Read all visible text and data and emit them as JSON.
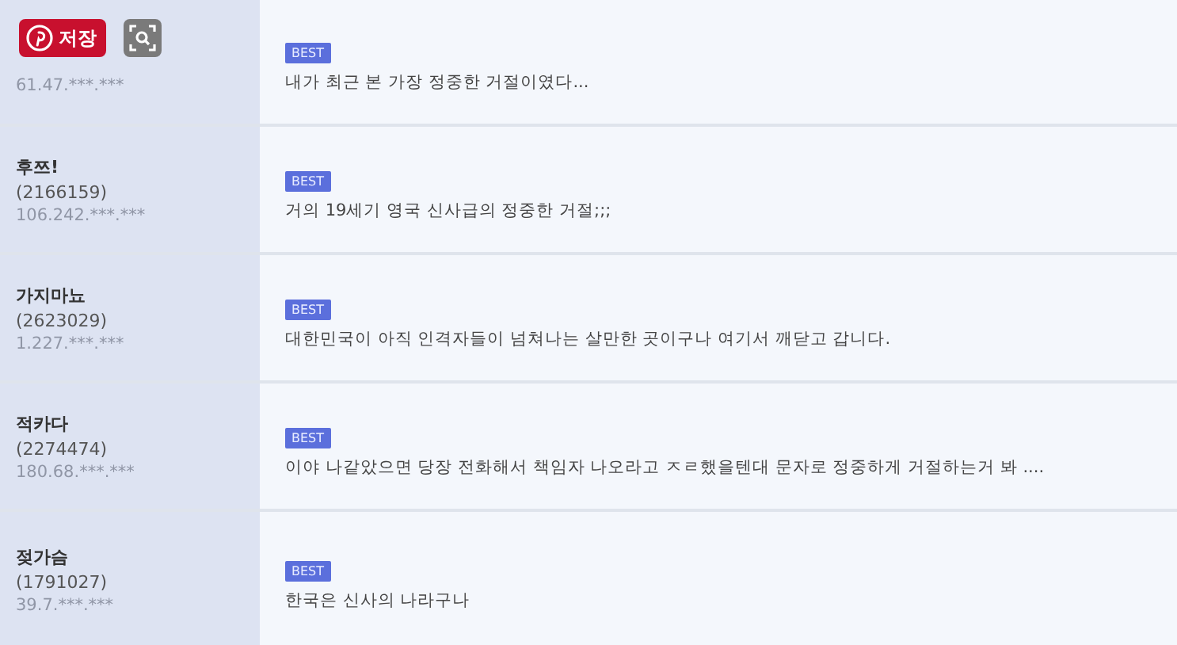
{
  "overlay": {
    "save_label": "저장"
  },
  "comments": [
    {
      "ip": "61.47.***.***",
      "badge": "BEST",
      "text": "내가 최근 본 가장 정중한 거절이였다..."
    },
    {
      "name": "후쯔!",
      "user_id": "(2166159)",
      "ip": "106.242.***.***",
      "badge": "BEST",
      "text": "거의 19세기 영국 신사급의 정중한 거절;;;"
    },
    {
      "name": "가지마뇨",
      "user_id": "(2623029)",
      "ip": "1.227.***.***",
      "badge": "BEST",
      "text": "대한민국이 아직 인격자들이 넘쳐나는 살만한 곳이구나 여기서 깨닫고 갑니다."
    },
    {
      "name": "적카다",
      "user_id": "(2274474)",
      "ip": "180.68.***.***",
      "badge": "BEST",
      "text": "이야 나같았으면 당장 전화해서 책임자 나오라고 ㅈㄹ했을텐대 문자로 정중하게 거절하는거 봐 ...."
    },
    {
      "name": "젖가슴",
      "user_id": "(1791027)",
      "ip": "39.7.***.***",
      "badge": "BEST",
      "text": "한국은 신사의 나라구나"
    }
  ]
}
